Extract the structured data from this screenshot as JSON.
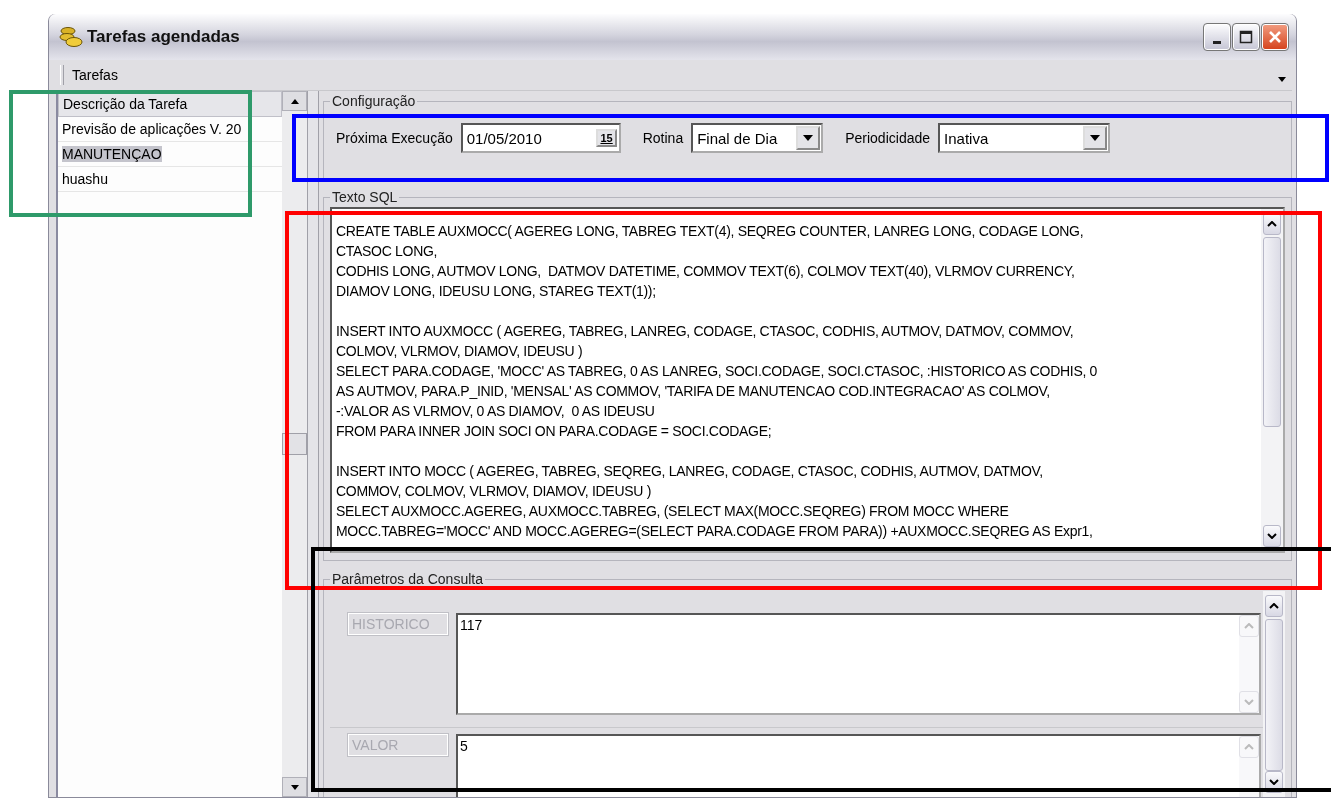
{
  "window": {
    "title": "Tarefas agendadas"
  },
  "menu": [
    {
      "label": "Tarefas"
    }
  ],
  "task_list": {
    "header": "Descrição da Tarefa",
    "rows": [
      {
        "label": "Previsão de aplicações V. 20",
        "selected": false
      },
      {
        "label": "MANUTENÇAO",
        "selected": true
      },
      {
        "label": "huashu",
        "selected": false
      }
    ]
  },
  "configuration": {
    "title": "Configuração",
    "fields": [
      {
        "kind": "date",
        "label": "Próxima Execução",
        "value": "01/05/2010",
        "button": "15"
      },
      {
        "kind": "select",
        "label": "Rotina",
        "value": "Final de Dia"
      },
      {
        "kind": "select",
        "label": "Periodicidade",
        "value": "Inativa"
      }
    ]
  },
  "sql": {
    "title": "Texto SQL",
    "paragraphs": [
      [
        "CREATE TABLE AUXMOCC( AGEREG LONG, TABREG TEXT(4), SEQREG COUNTER, LANREG LONG, CODAGE LONG,",
        "CTASOC LONG,",
        "CODHIS LONG, AUTMOV LONG,  DATMOV DATETIME, COMMOV TEXT(6), COLMOV TEXT(40), VLRMOV CURRENCY,",
        "DIAMOV LONG, IDEUSU LONG, STAREG TEXT(1));"
      ],
      [
        "INSERT INTO AUXMOCC ( AGEREG, TABREG, LANREG, CODAGE, CTASOC, CODHIS, AUTMOV, DATMOV, COMMOV,",
        "COLMOV, VLRMOV, DIAMOV, IDEUSU )",
        "SELECT PARA.CODAGE, 'MOCC' AS TABREG, 0 AS LANREG, SOCI.CODAGE, SOCI.CTASOC, :HISTORICO AS CODHIS, 0",
        "AS AUTMOV, PARA.P_INID, 'MENSAL' AS COMMOV, 'TARIFA DE MANUTENCAO COD.INTEGRACAO' AS COLMOV,",
        "-:VALOR AS VLRMOV, 0 AS DIAMOV,  0 AS IDEUSU",
        "FROM PARA INNER JOIN SOCI ON PARA.CODAGE = SOCI.CODAGE;"
      ],
      [
        "INSERT INTO MOCC ( AGEREG, TABREG, SEQREG, LANREG, CODAGE, CTASOC, CODHIS, AUTMOV, DATMOV,",
        "COMMOV, COLMOV, VLRMOV, DIAMOV, IDEUSU )",
        "SELECT AUXMOCC.AGEREG, AUXMOCC.TABREG, (SELECT MAX(MOCC.SEQREG) FROM MOCC WHERE",
        "MOCC.TABREG='MOCC' AND MOCC.AGEREG=(SELECT PARA.CODAGE FROM PARA)) +AUXMOCC.SEQREG AS Expr1,"
      ]
    ]
  },
  "parameters": {
    "title": "Parâmetros da Consulta",
    "items": [
      {
        "name": "HISTORICO",
        "value": "117"
      },
      {
        "name": "VALOR",
        "value": "5"
      }
    ]
  },
  "annotations": [
    {
      "color": "#2e9a6a"
    },
    {
      "color": "#0000ff"
    },
    {
      "color": "#ff0000"
    },
    {
      "color": "#000000"
    }
  ]
}
